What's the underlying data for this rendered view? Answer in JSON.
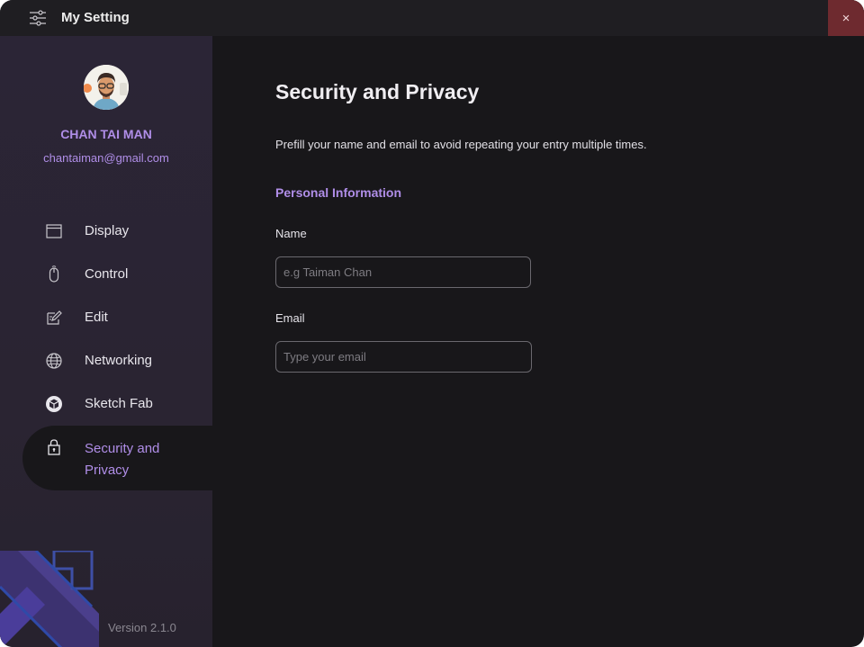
{
  "window": {
    "title": "My Setting",
    "close_symbol": "×",
    "settings_icon": "sliders-icon"
  },
  "sidebar": {
    "user": {
      "name": "CHAN TAI MAN",
      "email": "chantaiman@gmail.com"
    },
    "items": [
      {
        "label": "Display",
        "icon": "display-icon",
        "active": false
      },
      {
        "label": "Control",
        "icon": "mouse-icon",
        "active": false
      },
      {
        "label": "Edit",
        "icon": "edit-icon",
        "active": false
      },
      {
        "label": "Networking",
        "icon": "globe-icon",
        "active": false
      },
      {
        "label": "Sketch Fab",
        "icon": "sketchfab-icon",
        "active": false
      },
      {
        "label": "Security and Privacy",
        "icon": "lock-icon",
        "active": true
      }
    ],
    "version": "Version 2.1.0"
  },
  "main": {
    "title": "Security and Privacy",
    "description": "Prefill your name and email to avoid repeating your entry multiple times.",
    "section_title": "Personal Information",
    "fields": {
      "name": {
        "label": "Name",
        "placeholder": "e.g Taiman Chan",
        "value": ""
      },
      "email": {
        "label": "Email",
        "placeholder": "Type your email",
        "value": ""
      }
    }
  },
  "colors": {
    "accent": "#b08ee8",
    "close_bg": "#6e2a2f",
    "background": "#18171a",
    "sidebar": "#2b2536"
  }
}
